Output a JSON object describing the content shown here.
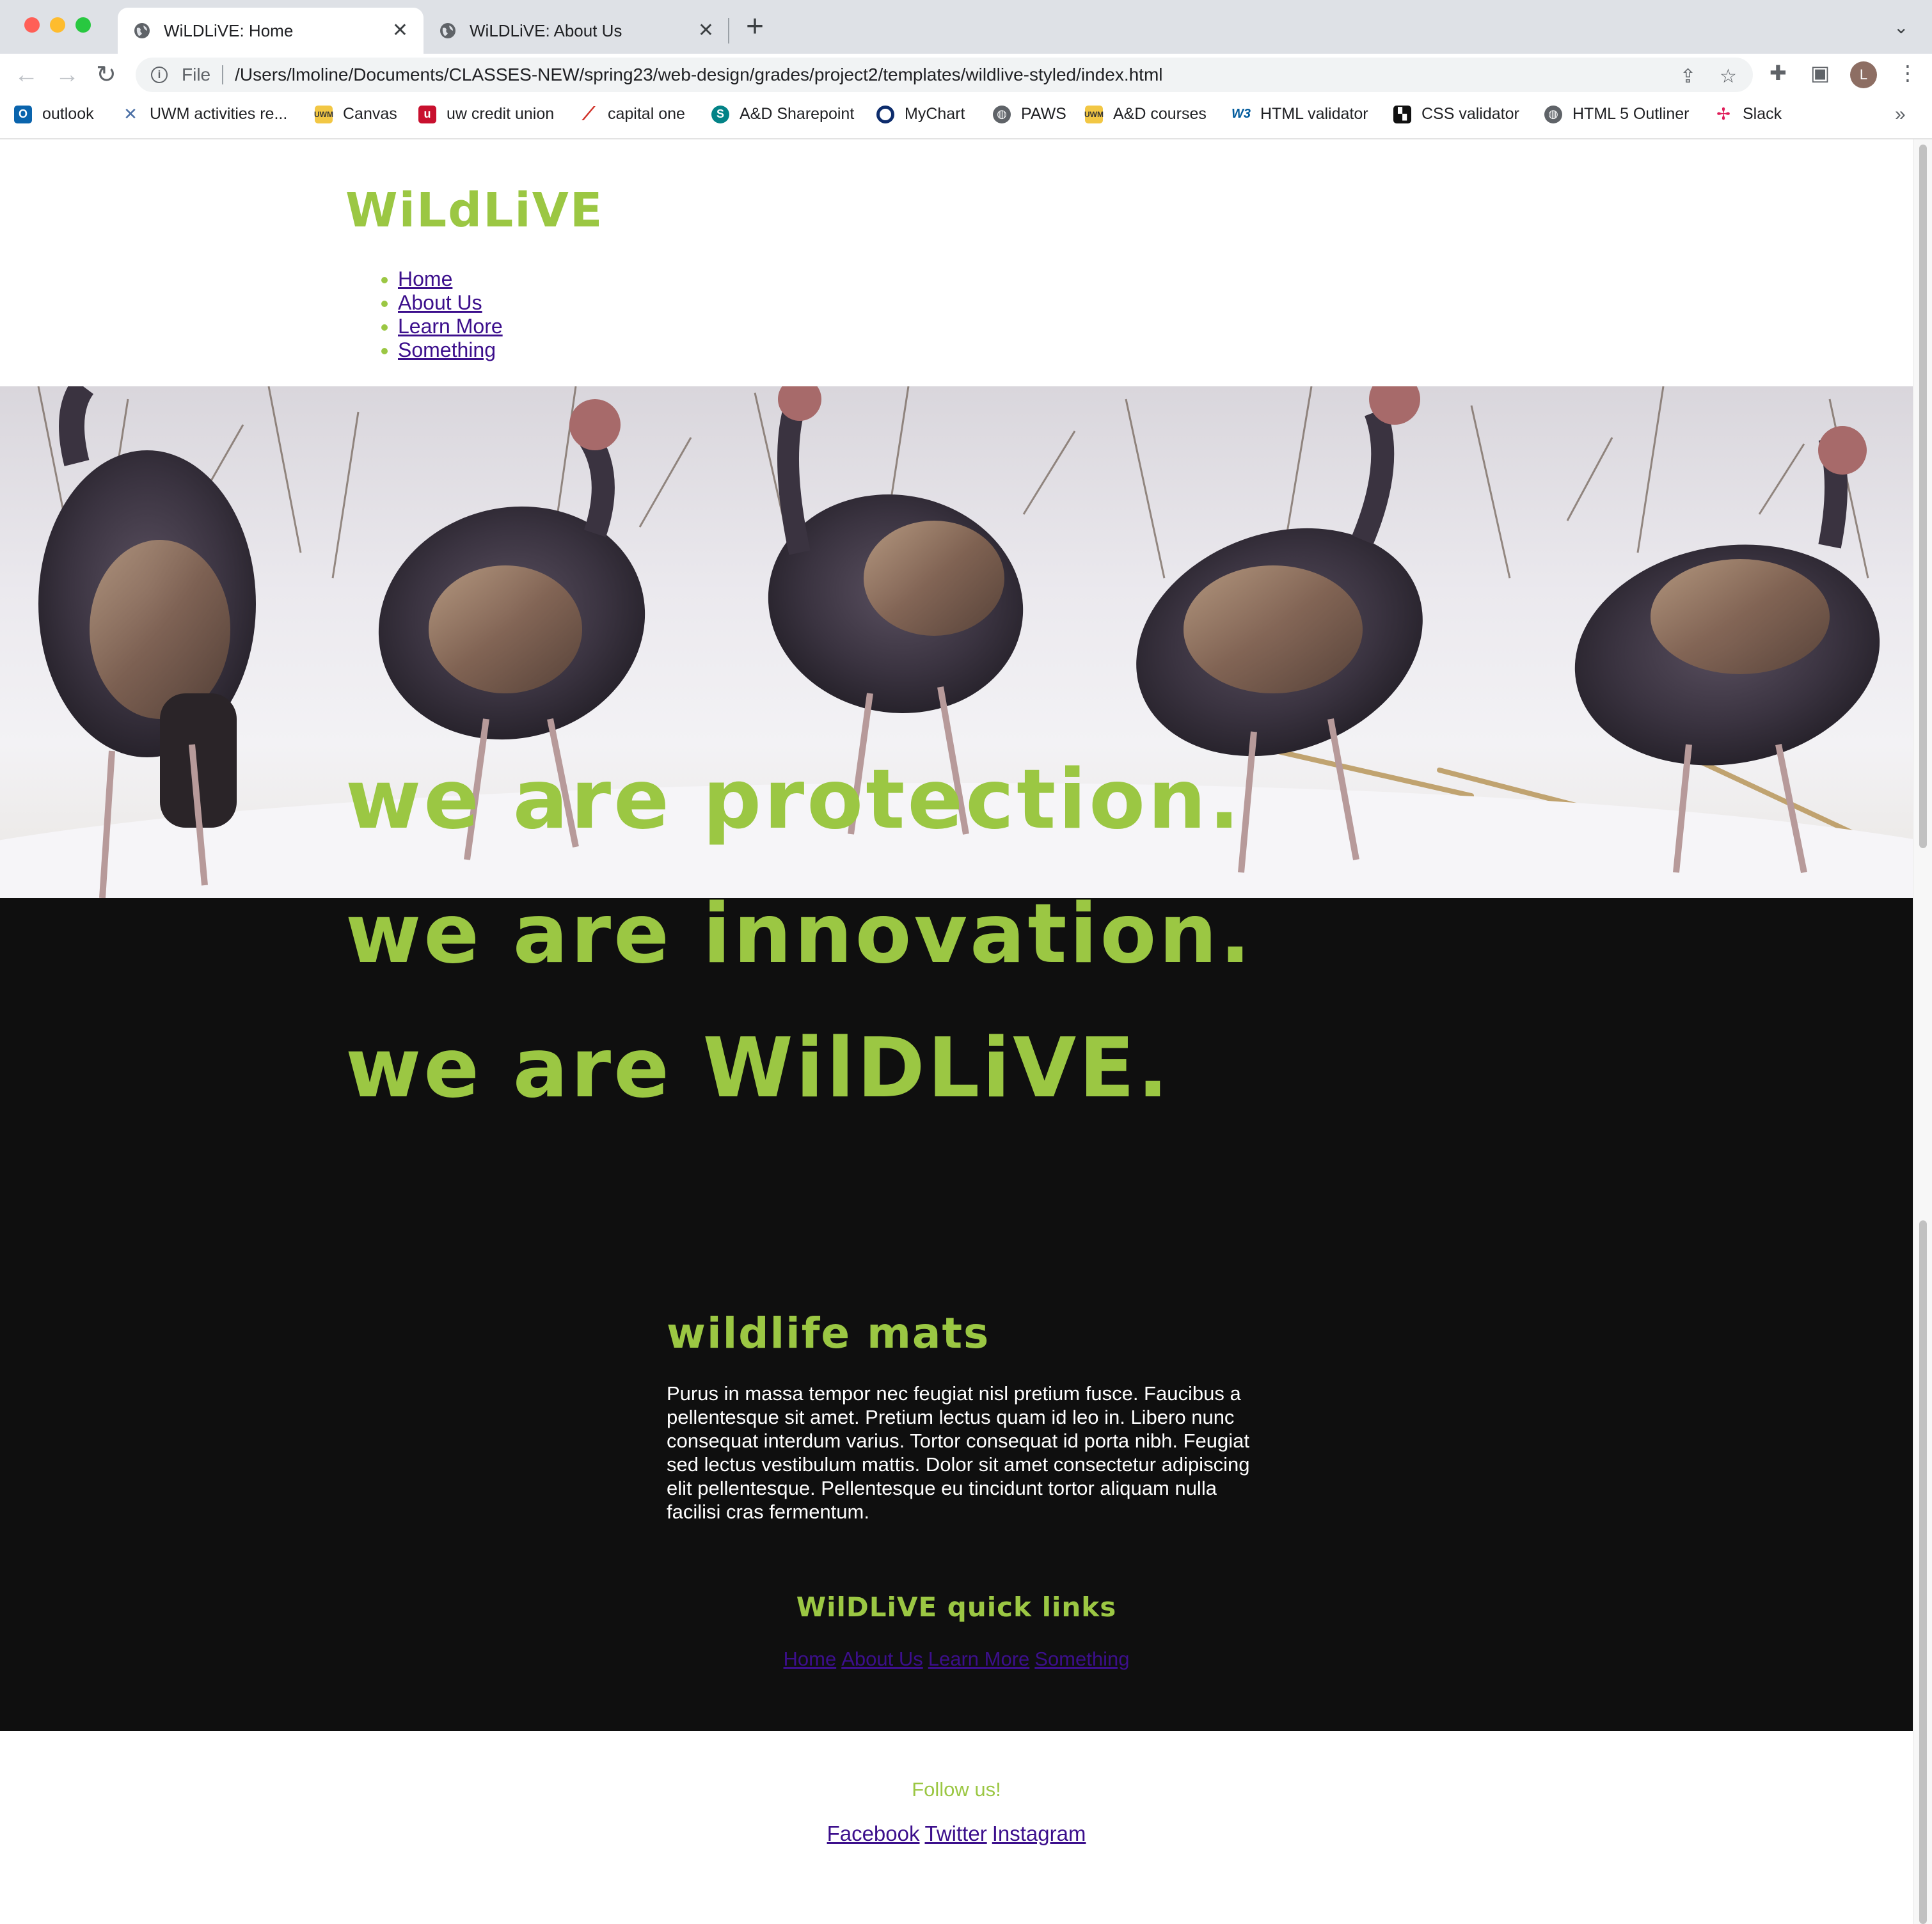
{
  "browser": {
    "tabs": [
      {
        "title": "WiLDLiVE: Home",
        "active": true
      },
      {
        "title": "WiLDLiVE: About Us",
        "active": false
      }
    ],
    "omnibox": {
      "scheme_label": "File",
      "url": "/Users/lmoline/Documents/CLASSES-NEW/spring23/web-design/grades/project2/templates/wildlive-styled/index.html"
    },
    "avatar_letter": "L",
    "bookmarks": [
      {
        "label": "outlook",
        "icon": "outlook-icon",
        "color": "#0a64ad"
      },
      {
        "label": "UWM activities re...",
        "icon": "tools-icon",
        "color": "#4a6fa5"
      },
      {
        "label": "Canvas",
        "icon": "uwm-icon",
        "color": "#d4a017"
      },
      {
        "label": "uw credit union",
        "icon": "uwcu-icon",
        "color": "#c8102e"
      },
      {
        "label": "capital one",
        "icon": "capital-one-icon",
        "color": "#d03027"
      },
      {
        "label": "A&D Sharepoint",
        "icon": "sharepoint-icon",
        "color": "#038387"
      },
      {
        "label": "MyChart",
        "icon": "mychart-icon",
        "color": "#0d2c6c"
      },
      {
        "label": "PAWS",
        "icon": "globe-icon",
        "color": "#5f6368"
      },
      {
        "label": "A&D courses",
        "icon": "uwm-icon",
        "color": "#d4a017"
      },
      {
        "label": "HTML validator",
        "icon": "w3c-icon",
        "color": "#005a9c"
      },
      {
        "label": "CSS validator",
        "icon": "css-icon",
        "color": "#111111"
      },
      {
        "label": "HTML 5 Outliner",
        "icon": "globe-icon",
        "color": "#5f6368"
      },
      {
        "label": "Slack",
        "icon": "slack-icon",
        "color": "#4a154b"
      }
    ]
  },
  "page": {
    "logo": "WiLdLiVE",
    "nav": [
      "Home",
      "About Us",
      "Learn More",
      "Something"
    ],
    "hero_image": "wild-turkeys-in-snow",
    "taglines": [
      "we are protection.",
      "we are innovation.",
      "we are WilDLiVE."
    ],
    "section": {
      "heading": "wildlife mats",
      "body": "Purus in massa tempor nec feugiat nisl pretium fusce. Faucibus a pellentesque sit amet. Pretium lectus quam id leo in. Libero nunc consequat interdum varius. Tortor consequat id porta nibh. Feugiat sed lectus vestibulum mattis. Dolor sit amet consectetur adipiscing elit pellentesque. Pellentesque eu tincidunt tortor aliquam nulla facilisi cras fermentum."
    },
    "quick_links": {
      "heading": "WilDLiVE quick links",
      "links": [
        "Home",
        "About Us",
        "Learn More",
        "Something"
      ]
    },
    "footer": {
      "follow": "Follow us!",
      "social": [
        "Facebook",
        "Twitter",
        "Instagram"
      ]
    },
    "colors": {
      "accent": "#9bc743",
      "link": "#3c0f8c",
      "dark_band": "#0f0f0f"
    }
  }
}
